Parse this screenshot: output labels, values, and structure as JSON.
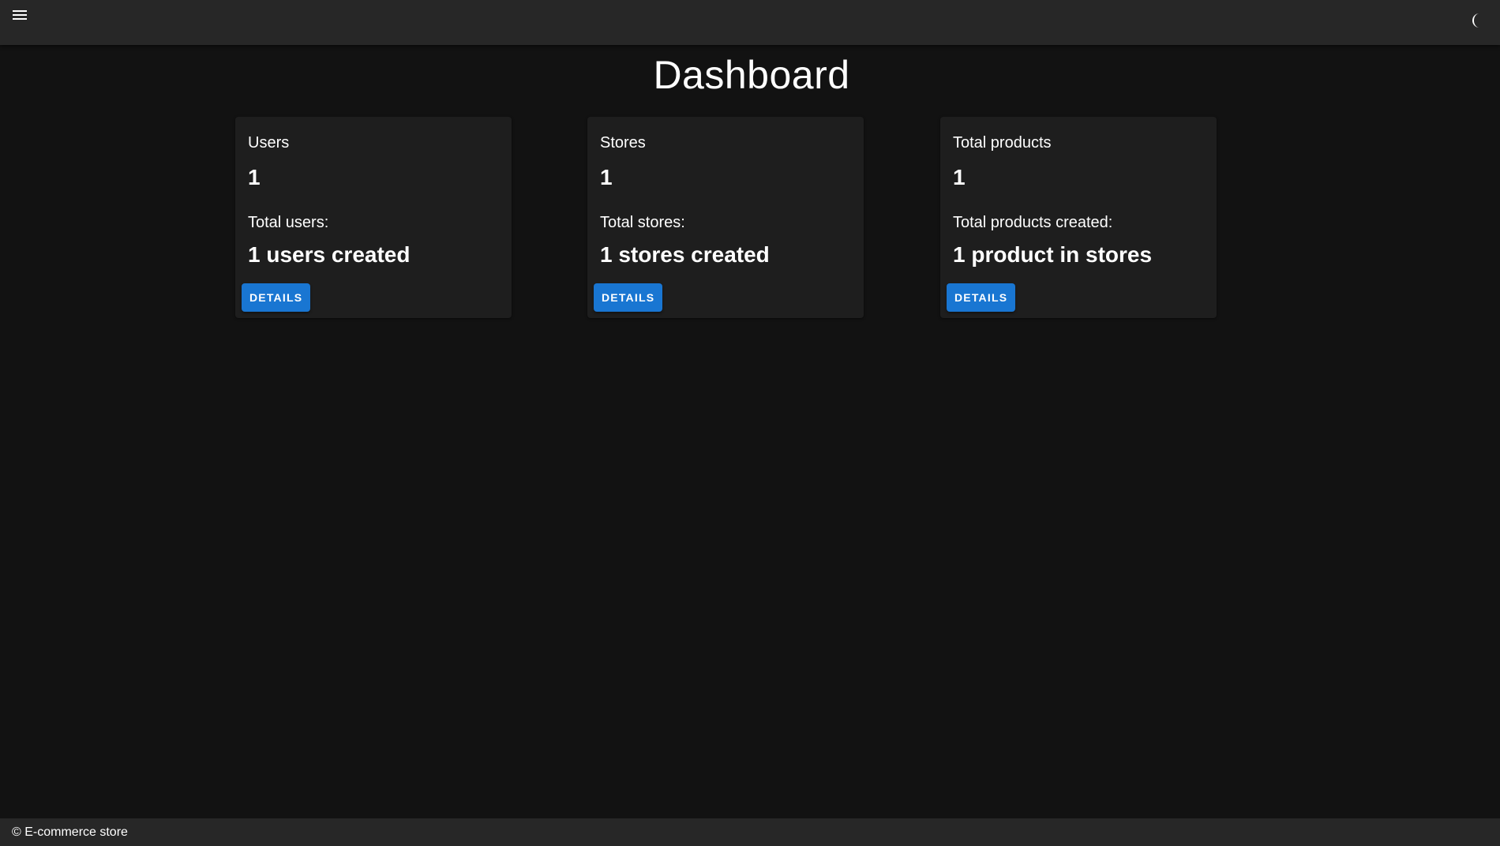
{
  "header": {
    "menu_icon": "menu-icon",
    "theme_icon": "moon-icon"
  },
  "page": {
    "title": "Dashboard"
  },
  "cards": [
    {
      "title": "Users",
      "count": "1",
      "subtitle": "Total users:",
      "summary": "1 users created",
      "button_label": "DETAILS"
    },
    {
      "title": "Stores",
      "count": "1",
      "subtitle": "Total stores:",
      "summary": "1 stores created",
      "button_label": "DETAILS"
    },
    {
      "title": "Total products",
      "count": "1",
      "subtitle": "Total products created:",
      "summary": "1 product in stores",
      "button_label": "DETAILS"
    }
  ],
  "footer": {
    "text": "© E-commerce store"
  },
  "colors": {
    "background": "#121212",
    "appbar": "#272727",
    "card": "#1e1e1e",
    "primary_button": "#1976d2",
    "text": "#ffffff"
  }
}
